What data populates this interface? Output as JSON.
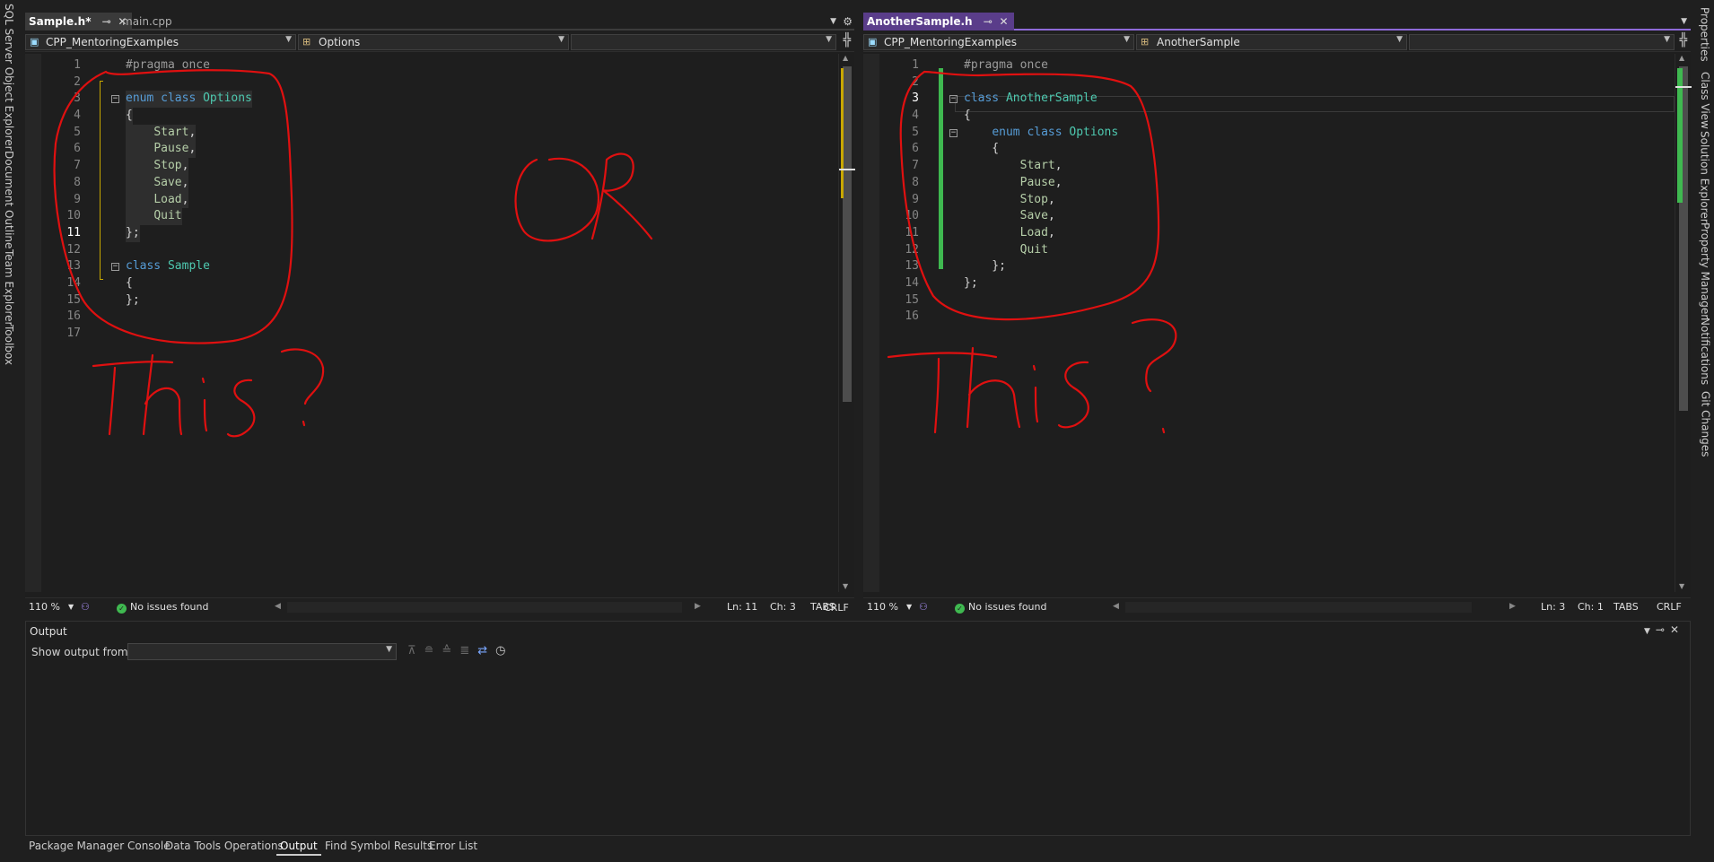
{
  "left_rail": {
    "items": [
      "SQL Server Object Explorer",
      "Document Outline",
      "Team Explorer",
      "Toolbox"
    ]
  },
  "right_rail": {
    "items": [
      "Properties",
      "Class View",
      "Solution Explorer",
      "Property Manager",
      "Notifications",
      "Git Changes"
    ]
  },
  "left_editor": {
    "tabs": [
      {
        "label": "Sample.h*",
        "active": true
      },
      {
        "label": "main.cpp",
        "active": false
      }
    ],
    "nav": {
      "project": "CPP_MentoringExamples",
      "scope": "Options",
      "member": ""
    },
    "lines": [
      {
        "n": "1",
        "segs": [
          [
            "pp",
            "#pragma once"
          ]
        ]
      },
      {
        "n": "2",
        "segs": []
      },
      {
        "n": "3",
        "segs": [
          [
            "kw",
            "enum class "
          ],
          [
            "ty",
            "Options"
          ]
        ],
        "fold": true
      },
      {
        "n": "4",
        "segs": [
          [
            "p",
            "{"
          ]
        ]
      },
      {
        "n": "5",
        "segs": [
          [
            "p",
            "    "
          ],
          [
            "en",
            "Start"
          ],
          [
            "p",
            ","
          ]
        ]
      },
      {
        "n": "6",
        "segs": [
          [
            "p",
            "    "
          ],
          [
            "en",
            "Pause"
          ],
          [
            "p",
            ","
          ]
        ]
      },
      {
        "n": "7",
        "segs": [
          [
            "p",
            "    "
          ],
          [
            "en",
            "Stop"
          ],
          [
            "p",
            ","
          ]
        ]
      },
      {
        "n": "8",
        "segs": [
          [
            "p",
            "    "
          ],
          [
            "en",
            "Save"
          ],
          [
            "p",
            ","
          ]
        ]
      },
      {
        "n": "9",
        "segs": [
          [
            "p",
            "    "
          ],
          [
            "en",
            "Load"
          ],
          [
            "p",
            ","
          ]
        ]
      },
      {
        "n": "10",
        "segs": [
          [
            "p",
            "    "
          ],
          [
            "en",
            "Quit"
          ]
        ]
      },
      {
        "n": "11",
        "segs": [
          [
            "p",
            "};"
          ]
        ],
        "current": true
      },
      {
        "n": "12",
        "segs": []
      },
      {
        "n": "13",
        "segs": [
          [
            "kw",
            "class "
          ],
          [
            "ty",
            "Sample"
          ]
        ],
        "fold": true
      },
      {
        "n": "14",
        "segs": [
          [
            "p",
            "{"
          ]
        ]
      },
      {
        "n": "15",
        "segs": [
          [
            "p",
            "};"
          ]
        ]
      },
      {
        "n": "16",
        "segs": []
      },
      {
        "n": "17",
        "segs": []
      }
    ],
    "status": {
      "zoom": "110 %",
      "issues": "No issues found",
      "ln": "Ln: 11",
      "ch": "Ch: 3",
      "indent": "TABS",
      "eol": "CRLF"
    },
    "annotations": {
      "top": "OR",
      "bottom": "This?"
    }
  },
  "right_editor": {
    "tabs": [
      {
        "label": "AnotherSample.h",
        "active": true
      }
    ],
    "nav": {
      "project": "CPP_MentoringExamples",
      "scope": "AnotherSample",
      "member": ""
    },
    "lines": [
      {
        "n": "1",
        "segs": [
          [
            "pp",
            "#pragma once"
          ]
        ]
      },
      {
        "n": "2",
        "segs": []
      },
      {
        "n": "3",
        "segs": [
          [
            "kw",
            "class "
          ],
          [
            "ty",
            "AnotherSample"
          ]
        ],
        "fold": true,
        "current": true
      },
      {
        "n": "4",
        "segs": [
          [
            "p",
            "{"
          ]
        ]
      },
      {
        "n": "5",
        "segs": [
          [
            "p",
            "    "
          ],
          [
            "kw",
            "enum class "
          ],
          [
            "ty",
            "Options"
          ]
        ],
        "fold": true
      },
      {
        "n": "6",
        "segs": [
          [
            "p",
            "    {"
          ]
        ]
      },
      {
        "n": "7",
        "segs": [
          [
            "p",
            "        "
          ],
          [
            "en",
            "Start"
          ],
          [
            "p",
            ","
          ]
        ]
      },
      {
        "n": "8",
        "segs": [
          [
            "p",
            "        "
          ],
          [
            "en",
            "Pause"
          ],
          [
            "p",
            ","
          ]
        ]
      },
      {
        "n": "9",
        "segs": [
          [
            "p",
            "        "
          ],
          [
            "en",
            "Stop"
          ],
          [
            "p",
            ","
          ]
        ]
      },
      {
        "n": "10",
        "segs": [
          [
            "p",
            "        "
          ],
          [
            "en",
            "Save"
          ],
          [
            "p",
            ","
          ]
        ]
      },
      {
        "n": "11",
        "segs": [
          [
            "p",
            "        "
          ],
          [
            "en",
            "Load"
          ],
          [
            "p",
            ","
          ]
        ]
      },
      {
        "n": "12",
        "segs": [
          [
            "p",
            "        "
          ],
          [
            "en",
            "Quit"
          ]
        ]
      },
      {
        "n": "13",
        "segs": [
          [
            "p",
            "    };"
          ]
        ]
      },
      {
        "n": "14",
        "segs": [
          [
            "p",
            "};"
          ]
        ]
      },
      {
        "n": "15",
        "segs": []
      },
      {
        "n": "16",
        "segs": []
      }
    ],
    "status": {
      "zoom": "110 %",
      "issues": "No issues found",
      "ln": "Ln: 3",
      "ch": "Ch: 1",
      "indent": "TABS",
      "eol": "CRLF"
    },
    "annotations": {
      "bottom": "This?"
    }
  },
  "output": {
    "title": "Output",
    "show_from_label": "Show output from:",
    "show_from_value": ""
  },
  "bottom_tabs": [
    {
      "label": "Package Manager Console",
      "active": false
    },
    {
      "label": "Data Tools Operations",
      "active": false
    },
    {
      "label": "Output",
      "active": true
    },
    {
      "label": "Find Symbol Results",
      "active": false
    },
    {
      "label": "Error List",
      "active": false
    }
  ],
  "colors": {
    "keyword": "#569cd6",
    "type": "#4ec9b0",
    "enum_member": "#b5cea8",
    "annotation_ink": "#e01010",
    "change_saved": "#3fb950",
    "change_unsaved": "#c8a800",
    "active_tab_accent": "#8e6ad8"
  }
}
